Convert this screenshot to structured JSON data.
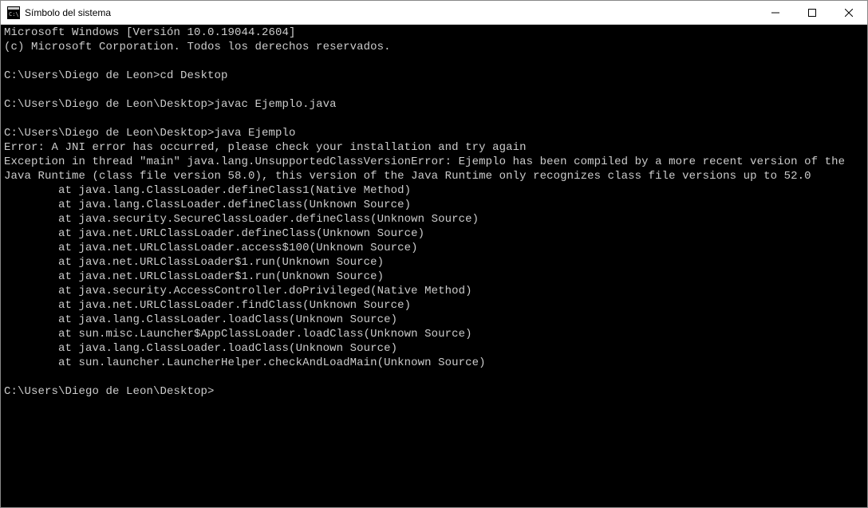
{
  "window": {
    "title": "Símbolo del sistema"
  },
  "terminal": {
    "banner_line1": "Microsoft Windows [Versión 10.0.19044.2604]",
    "banner_line2": "(c) Microsoft Corporation. Todos los derechos reservados.",
    "prompt1_path": "C:\\Users\\Diego de Leon>",
    "prompt1_cmd": "cd Desktop",
    "prompt2_path": "C:\\Users\\Diego de Leon\\Desktop>",
    "prompt2_cmd": "javac Ejemplo.java",
    "prompt3_path": "C:\\Users\\Diego de Leon\\Desktop>",
    "prompt3_cmd": "java Ejemplo",
    "err_line1": "Error: A JNI error has occurred, please check your installation and try again",
    "err_line2": "Exception in thread \"main\" java.lang.UnsupportedClassVersionError: Ejemplo has been compiled by a more recent version of the Java Runtime (class file version 58.0), this version of the Java Runtime only recognizes class file versions up to 52.0",
    "stack1": "        at java.lang.ClassLoader.defineClass1(Native Method)",
    "stack2": "        at java.lang.ClassLoader.defineClass(Unknown Source)",
    "stack3": "        at java.security.SecureClassLoader.defineClass(Unknown Source)",
    "stack4": "        at java.net.URLClassLoader.defineClass(Unknown Source)",
    "stack5": "        at java.net.URLClassLoader.access$100(Unknown Source)",
    "stack6": "        at java.net.URLClassLoader$1.run(Unknown Source)",
    "stack7": "        at java.net.URLClassLoader$1.run(Unknown Source)",
    "stack8": "        at java.security.AccessController.doPrivileged(Native Method)",
    "stack9": "        at java.net.URLClassLoader.findClass(Unknown Source)",
    "stack10": "        at java.lang.ClassLoader.loadClass(Unknown Source)",
    "stack11": "        at sun.misc.Launcher$AppClassLoader.loadClass(Unknown Source)",
    "stack12": "        at java.lang.ClassLoader.loadClass(Unknown Source)",
    "stack13": "        at sun.launcher.LauncherHelper.checkAndLoadMain(Unknown Source)",
    "prompt4_path": "C:\\Users\\Diego de Leon\\Desktop>"
  }
}
